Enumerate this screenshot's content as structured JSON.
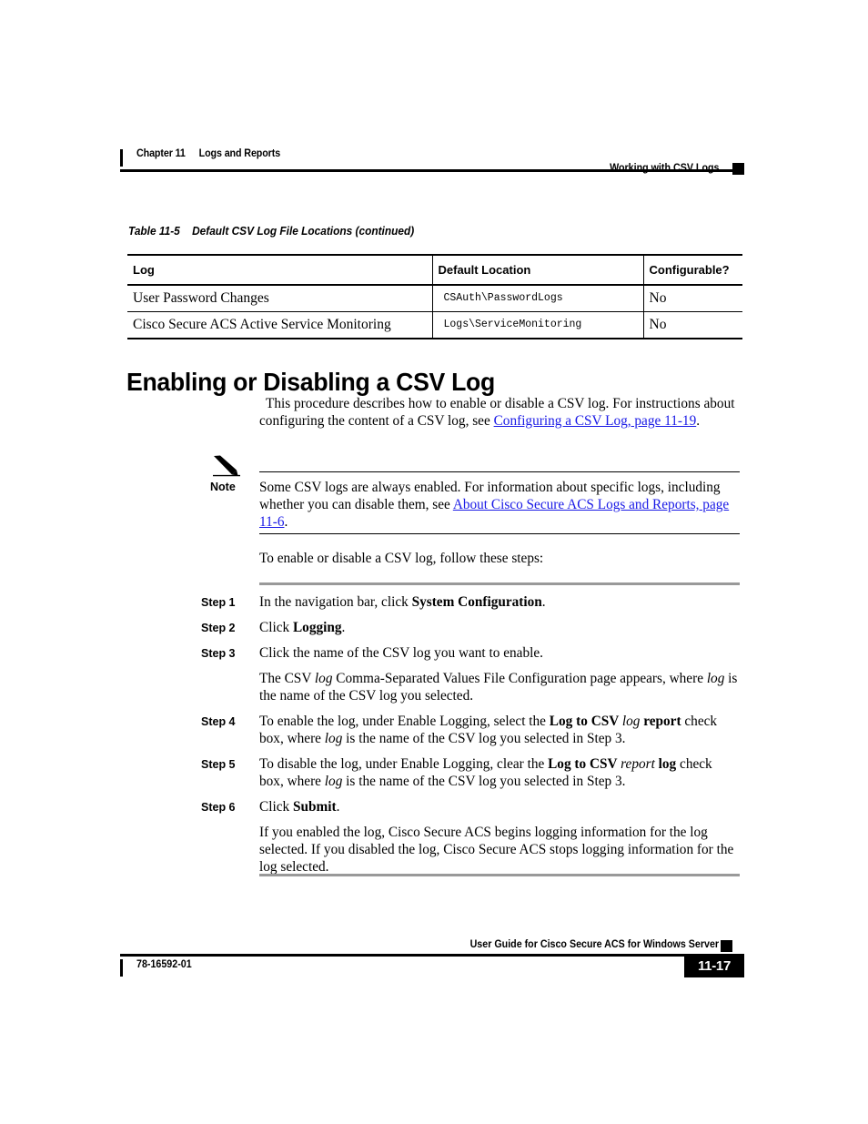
{
  "header": {
    "chapter": "Chapter 11",
    "chapter_title": "Logs and Reports",
    "running_head": "Working with CSV Logs"
  },
  "table": {
    "caption_number": "Table 11-5",
    "caption_title": "Default CSV Log File Locations (continued)",
    "columns": [
      "Log",
      "Default Location",
      "Configurable?"
    ],
    "rows": [
      {
        "log": "User Password Changes",
        "location": "CSAuth\\PasswordLogs",
        "configurable": "No"
      },
      {
        "log": "Cisco Secure ACS Active Service Monitoring",
        "location": "Logs\\ServiceMonitoring",
        "configurable": "No"
      }
    ]
  },
  "section": {
    "heading": "Enabling or Disabling a CSV Log",
    "intro": {
      "part1": "This procedure describes how to enable or disable a CSV log. For instructions about configuring the content of a CSV log, see ",
      "link": "Configuring a CSV Log, page 11-19",
      "part2": "."
    }
  },
  "note": {
    "icon": "pencil-icon",
    "label": "Note",
    "part1": "Some CSV logs are always enabled. For information about specific logs, including whether you can disable them, see ",
    "link": "About Cisco Secure ACS Logs and Reports, page 11-6",
    "part2": "."
  },
  "procedure": {
    "intro": "To enable or disable a CSV log, follow these steps:",
    "steps": [
      {
        "label": "Step 1",
        "segments": [
          {
            "text": "In the navigation bar, click ",
            "style": "normal"
          },
          {
            "text": "System Configuration",
            "style": "bold"
          },
          {
            "text": ".",
            "style": "normal"
          }
        ]
      },
      {
        "label": "Step 2",
        "segments": [
          {
            "text": "Click ",
            "style": "normal"
          },
          {
            "text": "Logging",
            "style": "bold"
          },
          {
            "text": ".",
            "style": "normal"
          }
        ]
      },
      {
        "label": "Step 3",
        "segments": [
          {
            "text": "Click the name of the CSV log you want to enable.",
            "style": "normal"
          }
        ],
        "continuation": [
          {
            "text": "The CSV ",
            "style": "normal"
          },
          {
            "text": "log",
            "style": "italic"
          },
          {
            "text": " Comma-Separated Values File Configuration page appears, where ",
            "style": "normal"
          },
          {
            "text": "log",
            "style": "italic"
          },
          {
            "text": " is the name of the CSV log you selected.",
            "style": "normal"
          }
        ]
      },
      {
        "label": "Step 4",
        "segments": [
          {
            "text": "To enable the log, under Enable Logging, select the ",
            "style": "normal"
          },
          {
            "text": "Log to CSV ",
            "style": "bold"
          },
          {
            "text": "log",
            "style": "italic"
          },
          {
            "text": " report",
            "style": "bold"
          },
          {
            "text": " check box, where ",
            "style": "normal"
          },
          {
            "text": "log",
            "style": "italic"
          },
          {
            "text": " is the name of the CSV log you selected in Step 3.",
            "style": "normal"
          }
        ]
      },
      {
        "label": "Step 5",
        "segments": [
          {
            "text": "To disable the log, under Enable Logging, clear the ",
            "style": "normal"
          },
          {
            "text": "Log to CSV ",
            "style": "bold"
          },
          {
            "text": "report",
            "style": "italic"
          },
          {
            "text": " log",
            "style": "bold"
          },
          {
            "text": " check box, where ",
            "style": "normal"
          },
          {
            "text": "log",
            "style": "italic"
          },
          {
            "text": " is the name of the CSV log you selected in Step 3.",
            "style": "normal"
          }
        ]
      },
      {
        "label": "Step 6",
        "segments": [
          {
            "text": "Click ",
            "style": "normal"
          },
          {
            "text": "Submit",
            "style": "bold"
          },
          {
            "text": ".",
            "style": "normal"
          }
        ],
        "continuation": [
          {
            "text": "If you enabled the log, Cisco Secure ACS begins logging information for the log selected. If you disabled the log, Cisco Secure ACS stops logging information for the log selected.",
            "style": "normal"
          }
        ]
      }
    ]
  },
  "footer": {
    "guide_title": "User Guide for Cisco Secure ACS for Windows Server",
    "doc_id": "78-16592-01",
    "page_number": "11-17"
  },
  "colors": {
    "link": "#1a1ae6",
    "rule_gray": "#999999",
    "text": "#000000"
  }
}
